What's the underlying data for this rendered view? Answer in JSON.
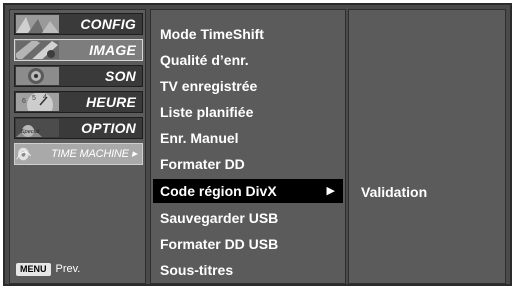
{
  "categories": [
    {
      "label": "CONFIG",
      "icon": "setup-thumbnail-icon"
    },
    {
      "label": "IMAGE",
      "icon": "picture-thumbnail-icon"
    },
    {
      "label": "SON",
      "icon": "audio-thumbnail-icon"
    },
    {
      "label": "HEURE",
      "icon": "clock-thumbnail-icon"
    },
    {
      "label": "OPTION",
      "icon": "special-thumbnail-icon"
    },
    {
      "label": "TIME MACHINE ▸",
      "icon": "time-machine-thumbnail-icon"
    }
  ],
  "footer": {
    "key": "MENU",
    "label": "Prev."
  },
  "options": [
    "Mode TimeShift",
    "Qualité d’enr.",
    "TV enregistrée",
    "Liste planifiée",
    "Enr. Manuel",
    "Formater DD",
    "Code région DivX",
    "Sauvegarder USB",
    "Formater DD USB",
    "Sous-titres"
  ],
  "selected_option_arrow": "▶",
  "submenu": {
    "value": "Validation"
  },
  "colors": {
    "panel": "#5b5b5b",
    "frame": "#4a4a4a",
    "highlight": "#000000",
    "active_category": "#a9a9a9",
    "text": "#ffffff"
  }
}
